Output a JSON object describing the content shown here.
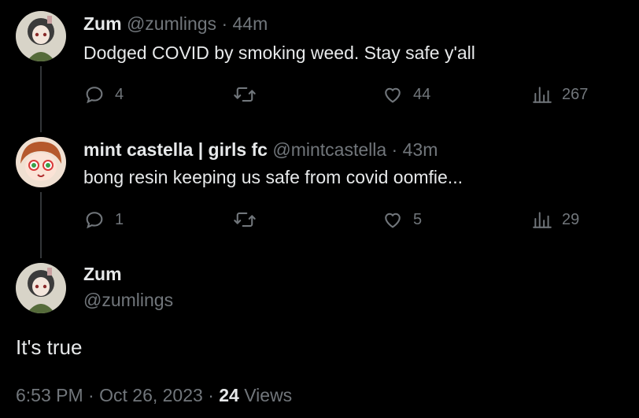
{
  "replies": [
    {
      "name": "Zum",
      "handle": "@zumlings",
      "separator": "·",
      "time": "44m",
      "text": "Dodged COVID by smoking weed. Stay safe y'all",
      "replies_count": "4",
      "retweets_count": "",
      "likes_count": "44",
      "views_count": "267"
    },
    {
      "name": "mint castella | girls fc",
      "handle": "@mintcastella",
      "separator": "·",
      "time": "43m",
      "text": "bong resin keeping us safe from covid oomfie...",
      "replies_count": "1",
      "retweets_count": "",
      "likes_count": "5",
      "views_count": "29"
    }
  ],
  "main_tweet": {
    "name": "Zum",
    "handle": "@zumlings",
    "text": "It's true",
    "time": "6:53 PM",
    "separator": "·",
    "date": "Oct 26, 2023",
    "views_count": "24",
    "views_label": "Views"
  },
  "icons": {
    "reply": "reply-icon",
    "retweet": "retweet-icon",
    "like": "like-icon",
    "views": "views-icon"
  },
  "colors": {
    "background": "#000000",
    "text": "#e7e9ea",
    "secondary": "#71767b",
    "thread_line": "#333639"
  }
}
